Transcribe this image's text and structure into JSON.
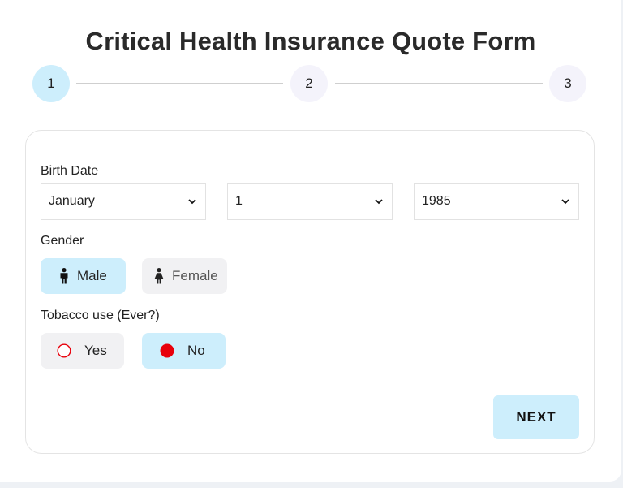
{
  "title": "Critical Health Insurance Quote Form",
  "stepper": {
    "steps": [
      {
        "label": "1",
        "state": "active"
      },
      {
        "label": "2",
        "state": "inactive"
      },
      {
        "label": "3",
        "state": "inactive"
      }
    ]
  },
  "form": {
    "birth_date": {
      "label": "Birth Date",
      "month": "January",
      "day": "1",
      "year": "1985"
    },
    "gender": {
      "label": "Gender",
      "options": [
        {
          "label": "Male",
          "icon": "male-icon",
          "selected": true
        },
        {
          "label": "Female",
          "icon": "female-icon",
          "selected": false
        }
      ]
    },
    "tobacco": {
      "label": "Tobacco use (Ever?)",
      "options": [
        {
          "label": "Yes",
          "selected": false
        },
        {
          "label": "No",
          "selected": true
        }
      ]
    },
    "next_label": "NEXT"
  },
  "colors": {
    "accent": "#cdeefc",
    "inactive_step": "#f4f3fb",
    "radio_red": "#e8000b",
    "unselected_pill": "#f1f1f3"
  }
}
